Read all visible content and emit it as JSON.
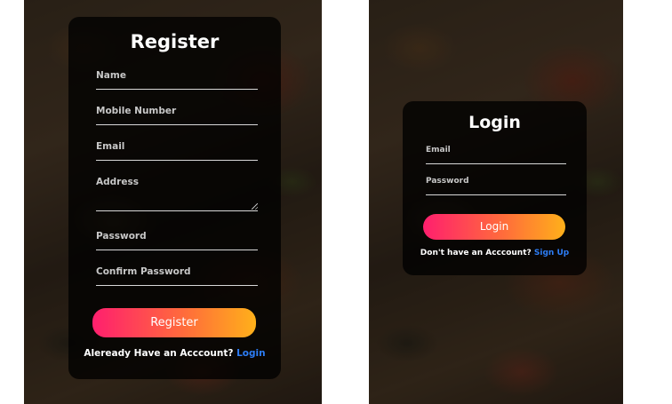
{
  "register": {
    "title": "Register",
    "fields": [
      "Name",
      "Mobile Number",
      "Email",
      "Address",
      "Password",
      "Confirm Password"
    ],
    "button_label": "Register",
    "footer_text": "Aleready Have an Acccount?",
    "footer_link": "Login"
  },
  "login": {
    "title": "Login",
    "fields": [
      "Email",
      "Password"
    ],
    "button_label": "Login",
    "footer_text": "Don't have an Acccount?",
    "footer_link": "Sign Up"
  },
  "colors": {
    "button_gradient_start": "#ff1f6e",
    "button_gradient_end": "#ffb01a",
    "link": "#2d7df6",
    "card_background": "rgba(0,0,0,0.78)"
  }
}
